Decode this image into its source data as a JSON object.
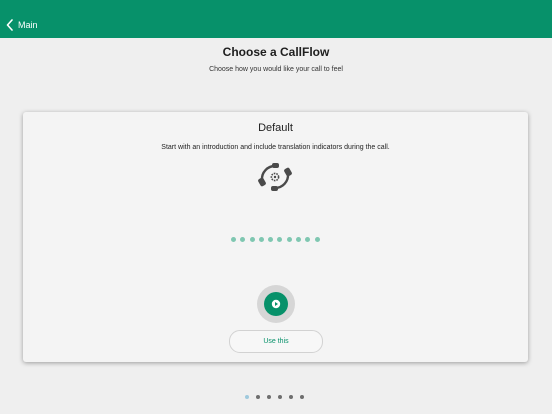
{
  "header": {
    "back_label": "Main",
    "color": "#07916a"
  },
  "page": {
    "title": "Choose a CallFlow",
    "subtitle": "Choose how you would like your call to feel"
  },
  "card": {
    "title": "Default",
    "description": "Start with an introduction and include translation indicators during the call.",
    "icon": "callflow-phone-gear-icon",
    "progress_dot_count": 10,
    "play_icon": "play-icon",
    "use_button_label": "Use this"
  },
  "pager": {
    "count": 6,
    "active_index": 0
  }
}
